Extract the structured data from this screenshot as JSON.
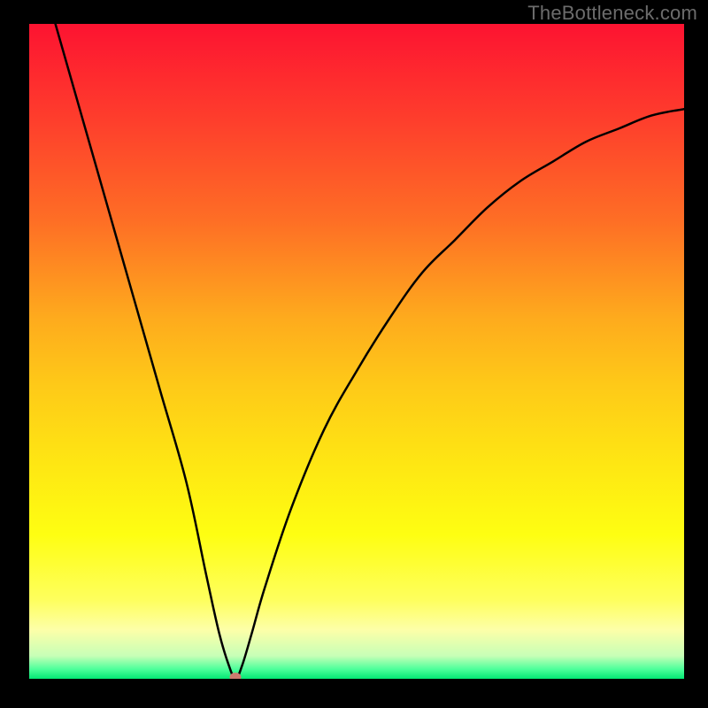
{
  "watermark": "TheBottleneck.com",
  "chart_data": {
    "type": "line",
    "title": "",
    "xlabel": "",
    "ylabel": "",
    "xlim": [
      0,
      100
    ],
    "ylim": [
      0,
      100
    ],
    "x": [
      4,
      8,
      12,
      16,
      20,
      24,
      27,
      29,
      30.5,
      31.5,
      32.5,
      34,
      36,
      40,
      45,
      50,
      55,
      60,
      65,
      70,
      75,
      80,
      85,
      90,
      95,
      100
    ],
    "values": [
      100,
      86,
      72,
      58,
      44,
      30,
      16,
      7,
      2,
      0,
      2,
      7,
      14,
      26,
      38,
      47,
      55,
      62,
      67,
      72,
      76,
      79,
      82,
      84,
      86,
      87
    ],
    "marker": {
      "x": 31.5,
      "y": 0
    },
    "gradient_stops": [
      {
        "offset": 0.0,
        "color": "#fd1331"
      },
      {
        "offset": 0.15,
        "color": "#fe3f2c"
      },
      {
        "offset": 0.3,
        "color": "#fe6e25"
      },
      {
        "offset": 0.45,
        "color": "#feab1d"
      },
      {
        "offset": 0.55,
        "color": "#fec918"
      },
      {
        "offset": 0.67,
        "color": "#fee613"
      },
      {
        "offset": 0.78,
        "color": "#fefe12"
      },
      {
        "offset": 0.88,
        "color": "#feff5e"
      },
      {
        "offset": 0.925,
        "color": "#fdffa8"
      },
      {
        "offset": 0.965,
        "color": "#c7ffb7"
      },
      {
        "offset": 0.985,
        "color": "#4fff9b"
      },
      {
        "offset": 1.0,
        "color": "#03e874"
      }
    ]
  }
}
